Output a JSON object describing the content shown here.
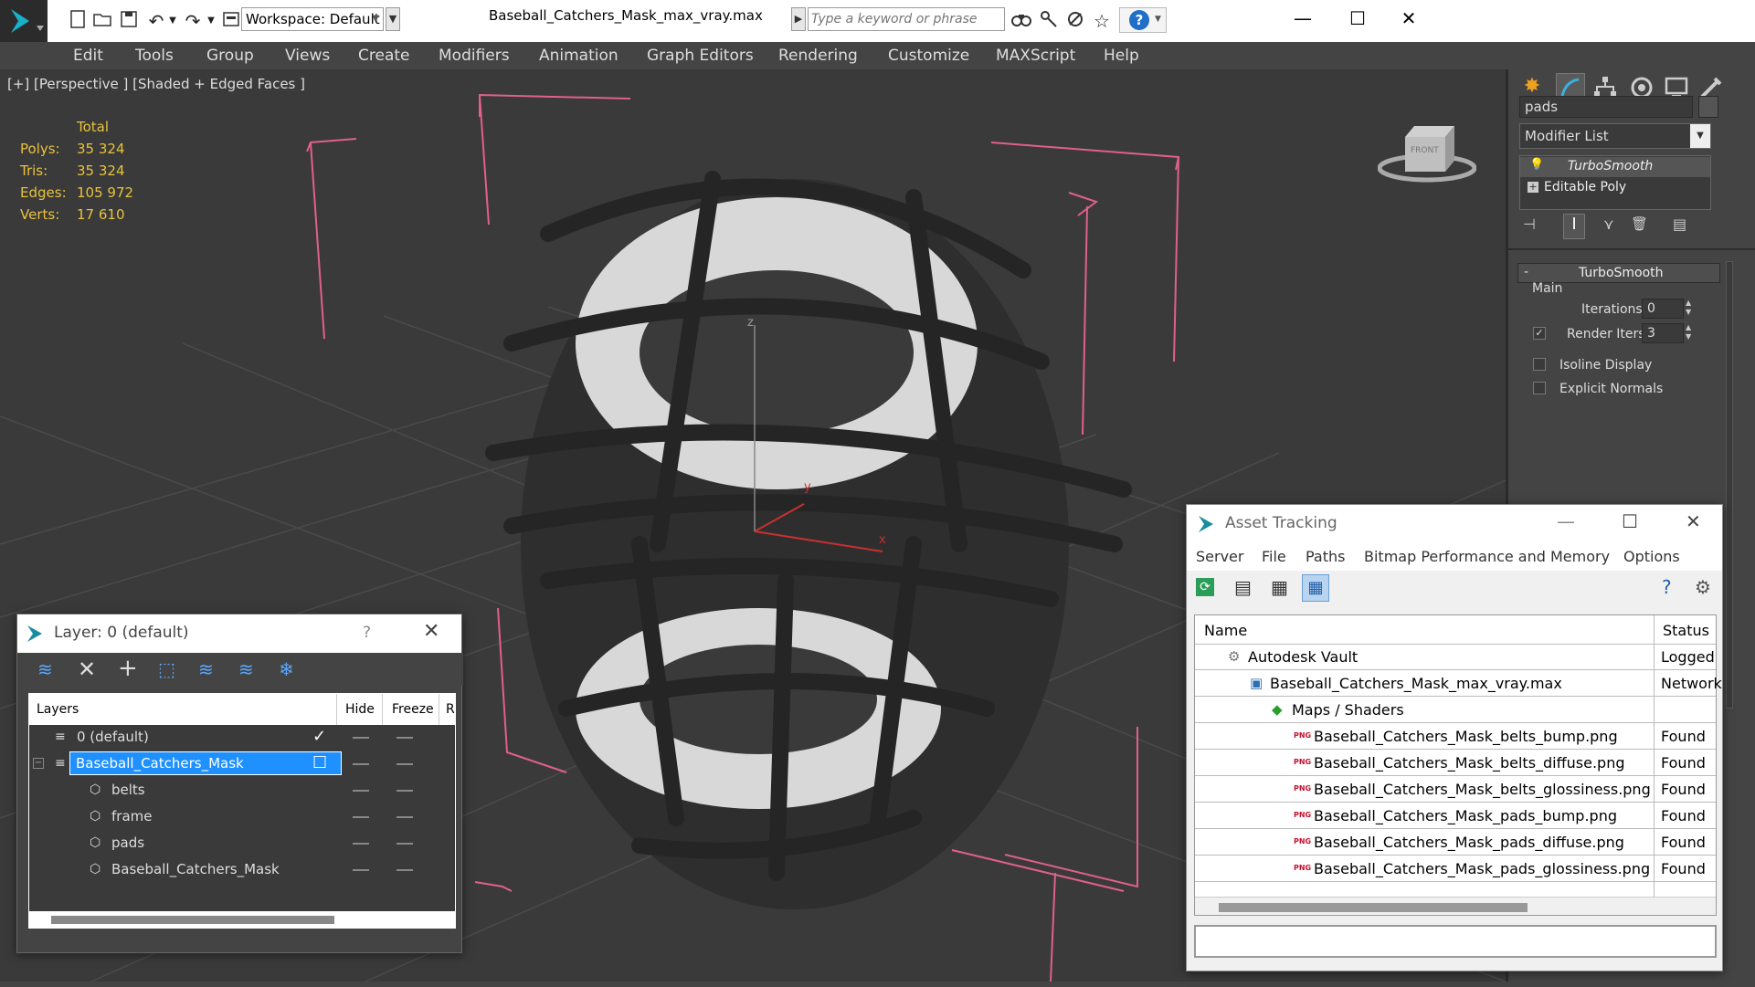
{
  "app": {
    "file_title": "Baseball_Catchers_Mask_max_vray.max",
    "workspace": "Workspace: Default",
    "search_placeholder": "Type a keyword or phrase"
  },
  "menu": [
    "Edit",
    "Tools",
    "Group",
    "Views",
    "Create",
    "Modifiers",
    "Animation",
    "Graph Editors",
    "Rendering",
    "Customize",
    "MAXScript",
    "Help"
  ],
  "viewport": {
    "label": "[+] [Perspective ] [Shaded + Edged Faces ]",
    "stats": {
      "header": "Total",
      "rows": [
        {
          "label": "Polys:",
          "value": "35 324"
        },
        {
          "label": "Tris:",
          "value": "35 324"
        },
        {
          "label": "Edges:",
          "value": "105 972"
        },
        {
          "label": "Verts:",
          "value": "17 610"
        }
      ]
    },
    "viewcube_label": "FRONT",
    "axis": {
      "x": "x",
      "y": "y",
      "z": "z"
    }
  },
  "command_panel": {
    "object_name": "pads",
    "modifier_list": "Modifier List",
    "stack": [
      "TurboSmooth",
      "Editable Poly"
    ],
    "rollout_title": "TurboSmooth",
    "group_main": "Main",
    "iterations_label": "Iterations:",
    "iterations_value": "0",
    "render_iters_label": "Render Iters:",
    "render_iters_value": "3",
    "render_iters_checked": true,
    "isoline_label": "Isoline Display",
    "explicit_normals_label": "Explicit Normals"
  },
  "layer_dialog": {
    "title": "Layer: 0 (default)",
    "help": "?",
    "columns": [
      "Layers",
      "Hide",
      "Freeze",
      "R"
    ],
    "rows": [
      {
        "name": "0 (default)",
        "indent": 0,
        "type": "layer",
        "current": true,
        "selected": false
      },
      {
        "name": "Baseball_Catchers_Mask",
        "indent": 0,
        "type": "layer",
        "current": false,
        "selected": true
      },
      {
        "name": "belts",
        "indent": 1,
        "type": "object",
        "current": false,
        "selected": false
      },
      {
        "name": "frame",
        "indent": 1,
        "type": "object",
        "current": false,
        "selected": false
      },
      {
        "name": "pads",
        "indent": 1,
        "type": "object",
        "current": false,
        "selected": false
      },
      {
        "name": "Baseball_Catchers_Mask",
        "indent": 1,
        "type": "object",
        "current": false,
        "selected": false
      }
    ]
  },
  "asset_dialog": {
    "title": "Asset Tracking",
    "menu": [
      "Server",
      "File",
      "Paths",
      "Bitmap Performance and Memory",
      "Options"
    ],
    "columns": [
      "Name",
      "Status"
    ],
    "rows": [
      {
        "name": "Autodesk Vault",
        "status": "Logged",
        "indent": 0,
        "icon": "vault"
      },
      {
        "name": "Baseball_Catchers_Mask_max_vray.max",
        "status": "Network",
        "indent": 1,
        "icon": "max"
      },
      {
        "name": "Maps / Shaders",
        "status": "",
        "indent": 2,
        "icon": "maps"
      },
      {
        "name": "Baseball_Catchers_Mask_belts_bump.png",
        "status": "Found",
        "indent": 3,
        "icon": "png"
      },
      {
        "name": "Baseball_Catchers_Mask_belts_diffuse.png",
        "status": "Found",
        "indent": 3,
        "icon": "png"
      },
      {
        "name": "Baseball_Catchers_Mask_belts_glossiness.png",
        "status": "Found",
        "indent": 3,
        "icon": "png"
      },
      {
        "name": "Baseball_Catchers_Mask_pads_bump.png",
        "status": "Found",
        "indent": 3,
        "icon": "png"
      },
      {
        "name": "Baseball_Catchers_Mask_pads_diffuse.png",
        "status": "Found",
        "indent": 3,
        "icon": "png"
      },
      {
        "name": "Baseball_Catchers_Mask_pads_glossiness.png",
        "status": "Found",
        "indent": 3,
        "icon": "png"
      }
    ]
  },
  "colors": {
    "stats_yellow": "#e8c23a",
    "selection_blue": "#1e90ff",
    "bbox_pink": "#e0608a",
    "viewport_bg": "#3a3a3a",
    "panel_bg": "#444444"
  }
}
